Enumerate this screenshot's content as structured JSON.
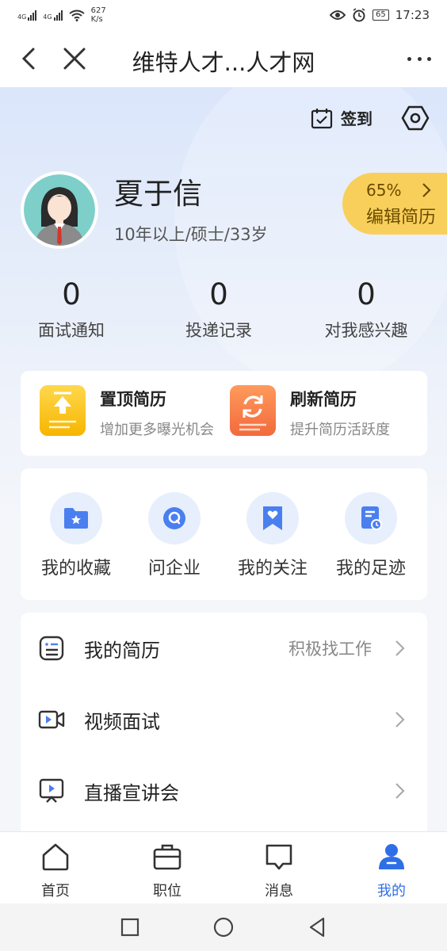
{
  "status_bar": {
    "network_1": "4G",
    "network_2": "4G",
    "speed_value": "627",
    "speed_unit": "K/s",
    "battery": "65",
    "time": "17:23"
  },
  "nav": {
    "title": "维特人才...人才网",
    "back_icon": "back-chevron-icon",
    "close_icon": "close-icon",
    "more_icon": "more-dots-icon"
  },
  "header": {
    "checkin_label": "签到",
    "checkin_icon": "calendar-check-icon",
    "settings_icon": "hexagon-settings-icon"
  },
  "profile": {
    "name": "夏于信",
    "info": "10年以上/硕士/33岁",
    "resume_completion": "65%",
    "resume_completion_value": 65,
    "edit_resume_label": "编辑简历",
    "badge_color": "#f9cf5b"
  },
  "stats": [
    {
      "value": "0",
      "label": "面试通知"
    },
    {
      "value": "0",
      "label": "投递记录"
    },
    {
      "value": "0",
      "label": "对我感兴趣"
    }
  ],
  "promos": [
    {
      "title": "置顶简历",
      "subtitle": "增加更多曝光机会",
      "icon": "pin-top-icon",
      "color": "#f7b500"
    },
    {
      "title": "刷新简历",
      "subtitle": "提升简历活跃度",
      "icon": "refresh-icon",
      "color": "#f26a3d"
    }
  ],
  "quick_actions": [
    {
      "label": "我的收藏",
      "icon": "folder-star-icon"
    },
    {
      "label": "问企业",
      "icon": "chat-bubble-icon"
    },
    {
      "label": "我的关注",
      "icon": "bookmark-heart-icon"
    },
    {
      "label": "我的足迹",
      "icon": "document-clock-icon"
    }
  ],
  "menu": [
    {
      "label": "我的简历",
      "value": "积极找工作",
      "icon": "resume-list-icon"
    },
    {
      "label": "视频面试",
      "value": "",
      "icon": "video-camera-icon"
    },
    {
      "label": "直播宣讲会",
      "value": "",
      "icon": "live-screen-icon"
    }
  ],
  "tabs": [
    {
      "label": "首页",
      "icon": "home-icon",
      "active": false
    },
    {
      "label": "职位",
      "icon": "briefcase-icon",
      "active": false
    },
    {
      "label": "消息",
      "icon": "message-icon",
      "active": false
    },
    {
      "label": "我的",
      "icon": "user-icon",
      "active": true
    }
  ],
  "colors": {
    "accent": "#2f6fe6",
    "icon_blue": "#4a7ff0",
    "icon_circle_bg": "#e7effc"
  }
}
